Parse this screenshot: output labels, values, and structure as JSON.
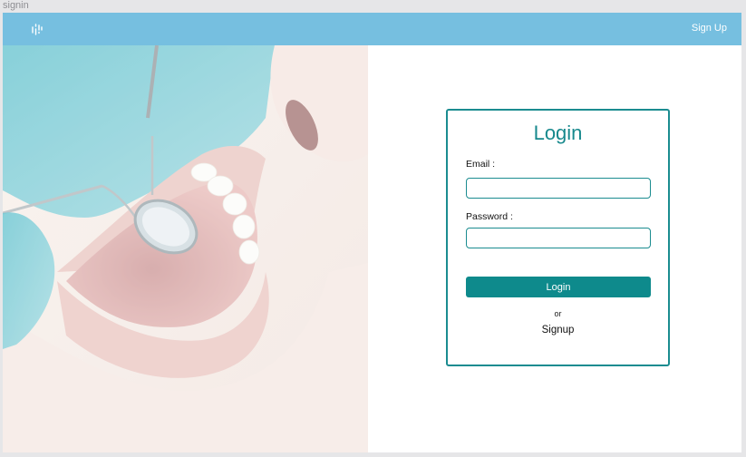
{
  "frame": {
    "label": "signin"
  },
  "navbar": {
    "signup_label": "Sign Up"
  },
  "login": {
    "title": "Login",
    "email_label": "Email :",
    "email_value": "",
    "password_label": "Password :",
    "password_value": "",
    "button_label": "Login",
    "or_text": "or",
    "signup_text": "Signup"
  },
  "colors": {
    "navbar": "#76bfe0",
    "accent": "#1b8c90",
    "button": "#0e8a8c"
  },
  "icons": {
    "logo": "brand-logo-icon"
  }
}
